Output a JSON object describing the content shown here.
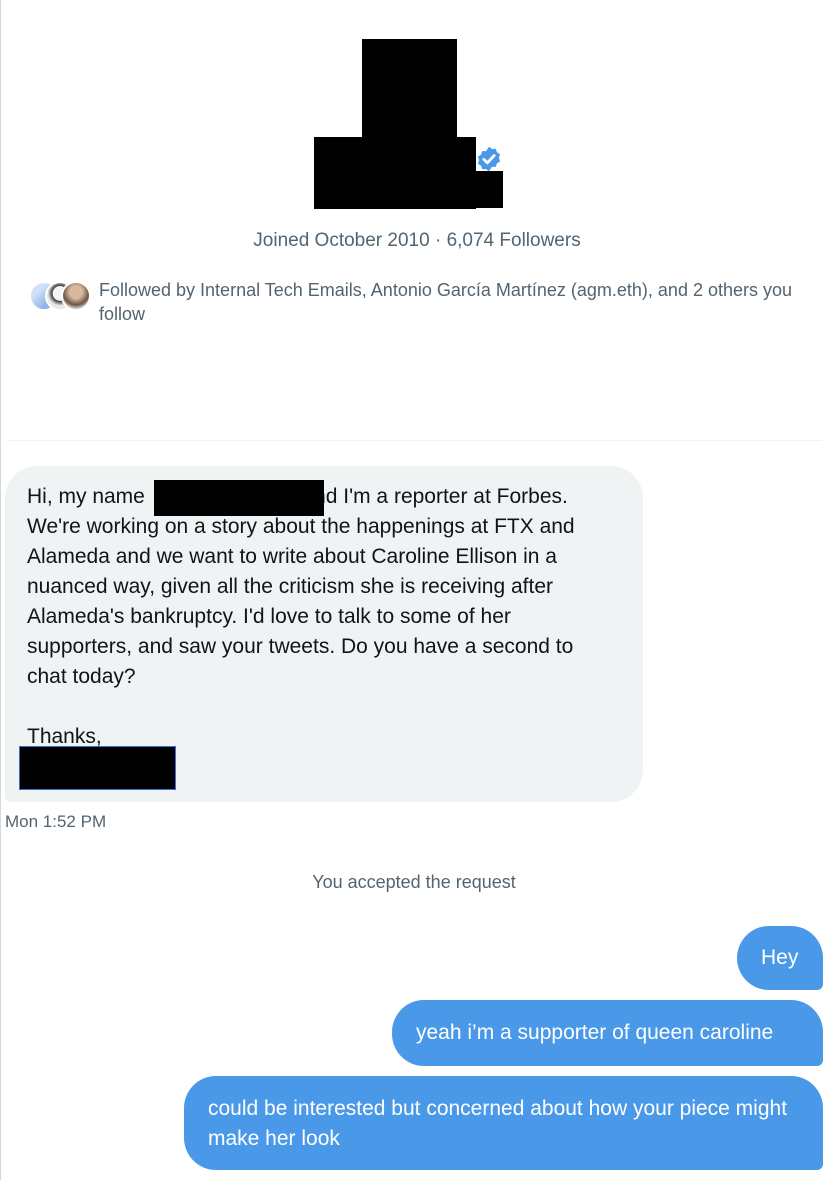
{
  "profile": {
    "joined_line": "Joined October 2010 · 6,074 Followers",
    "followed_by": "Followed by Internal Tech Emails, Antonio García Martínez (agm.eth), and 2 others you follow",
    "verified_badge_color": "#4a99e9"
  },
  "conversation": {
    "incoming_message": "Hi, my name                           and I'm a reporter at Forbes.\nWe're working on a story about the happenings at FTX and\nAlameda and we want to write about Caroline Ellison in a\nnuanced way, given all the criticism she is receiving after\nAlameda's bankruptcy. I'd love to talk to some of her\nsupporters, and saw your tweets. Do you have a second to\nchat today?\n\nThanks,",
    "incoming_timestamp": "Mon 1:52 PM",
    "system_note": "You accepted the request",
    "outgoing_messages": [
      "Hey",
      "yeah i’m a supporter of queen caroline",
      "could be interested but concerned about how your piece might make her look"
    ]
  },
  "colors": {
    "outgoing_bubble": "#4a99e9",
    "incoming_bubble": "#eff3f4",
    "secondary_text": "#536471"
  }
}
